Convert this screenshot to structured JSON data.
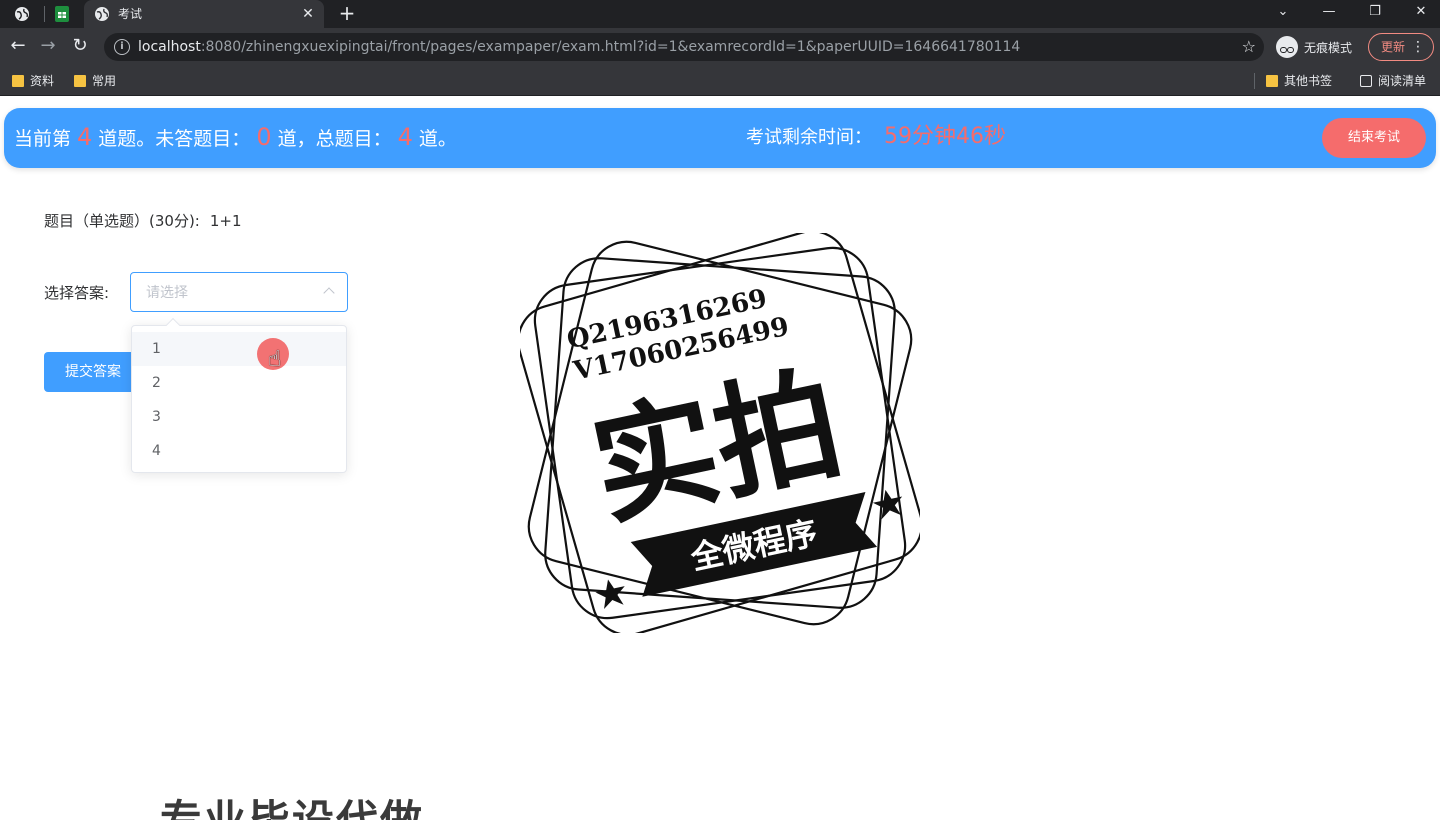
{
  "browser": {
    "tab_title": "考试",
    "url_host": "localhost",
    "url_rest": ":8080/zhinengxuexipingtai/front/pages/exampaper/exam.html?id=1&examrecordId=1&paperUUID=1646641780114",
    "incognito_label": "无痕模式",
    "update_label": "更新",
    "bookmarks": [
      "资料",
      "常用"
    ],
    "bookmarks_right": [
      "其他书签",
      "阅读清单"
    ]
  },
  "header": {
    "prefix": "当前第",
    "current": "4",
    "after_current": "道题。未答题目：",
    "unanswered": "0",
    "after_unanswered": "道，总题目：",
    "total": "4",
    "suffix": "道。",
    "time_label": "考试剩余时间：",
    "time_value": "59分钟46秒",
    "end_button": "结束考试"
  },
  "question": {
    "label": "题目（单选题）(30分):",
    "content": "1+1",
    "answer_label": "选择答案:",
    "select_placeholder": "请选择",
    "options": [
      "1",
      "2",
      "3",
      "4"
    ],
    "submit_button": "提交答案"
  },
  "watermark": {
    "line1": "Q2196316269",
    "line2": "V17060256499",
    "big": "实拍",
    "ribbon": "全微程序",
    "bottom": "专业毕设代做"
  },
  "colors": {
    "primary": "#409eff",
    "danger": "#f56c6c"
  }
}
